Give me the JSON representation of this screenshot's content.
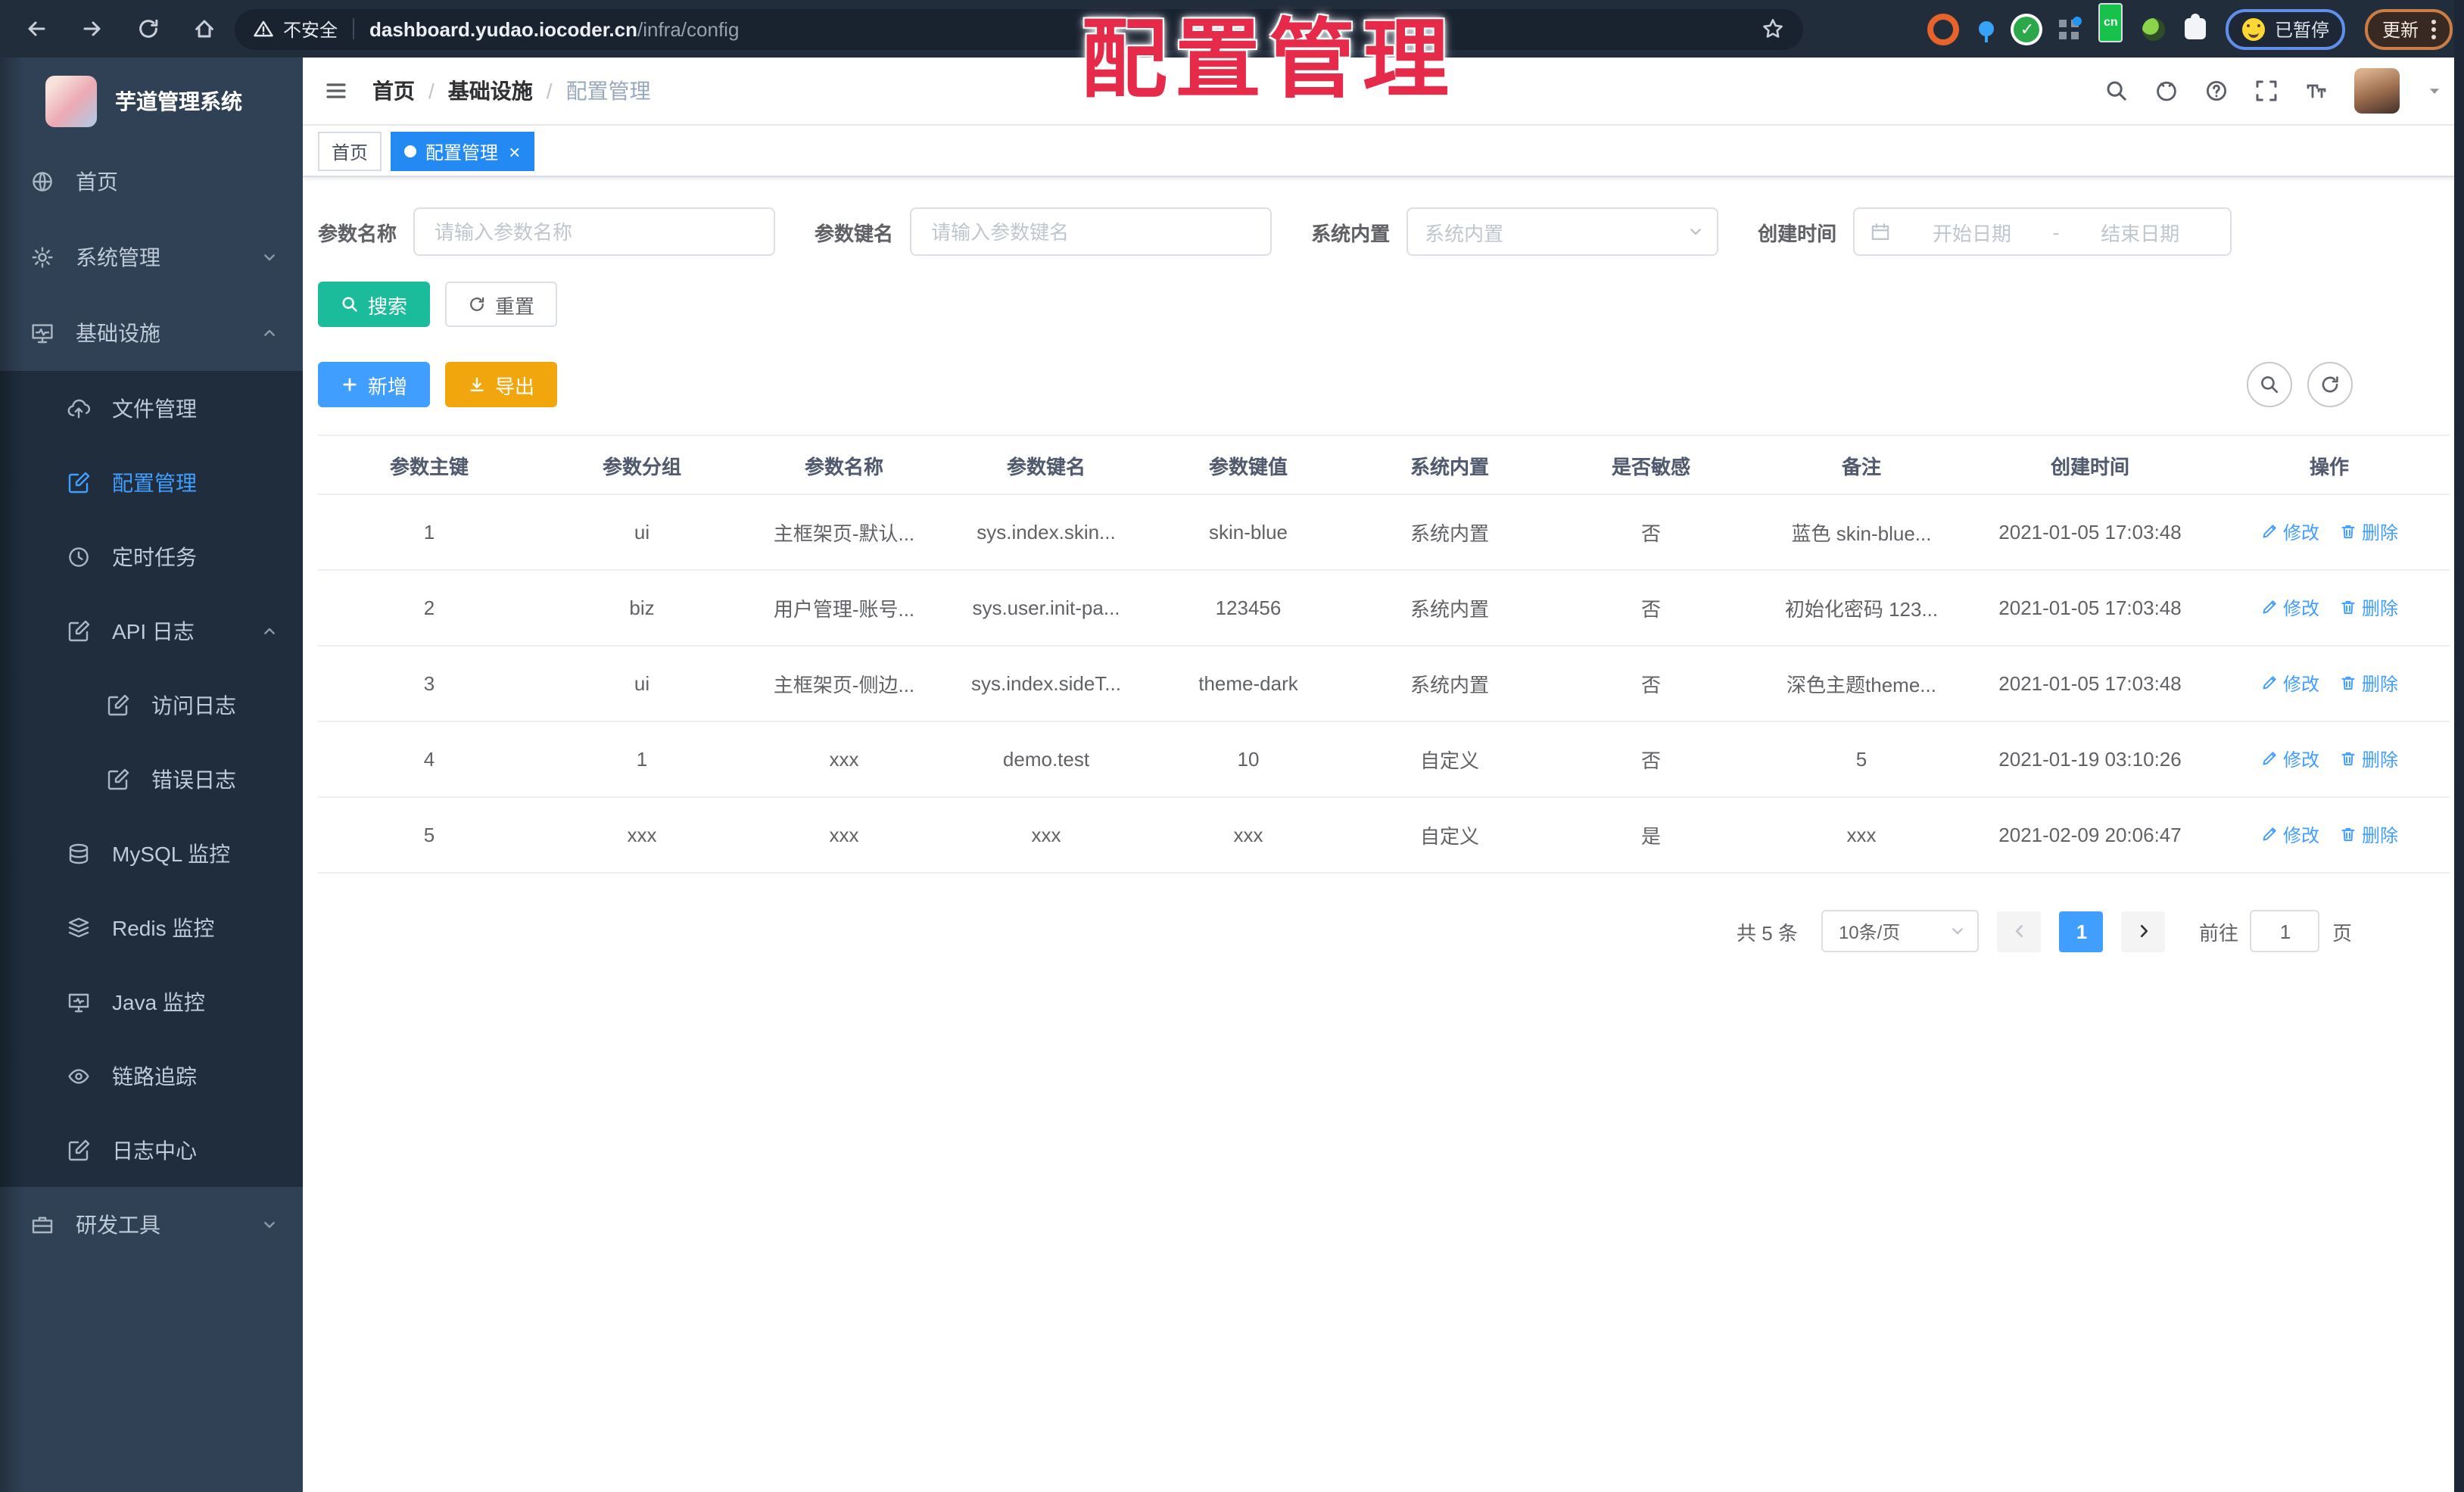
{
  "colors": {
    "accent": "#409eff",
    "active_tag": "#2389f3",
    "search_button": "#1abc9c",
    "export_button": "#f2a60d",
    "annotation_red": "#e62a4a",
    "sidebar_bg": "#304156",
    "submenu_bg": "#1f2d3d",
    "toolbar_bg": "#222d3c"
  },
  "browser": {
    "security_label": "不安全",
    "url_host": "dashboard.yudao.iocoder.cn",
    "url_path": "/infra/config",
    "ext_cn_label": "cn",
    "paused_label": "已暂停",
    "update_label": "更新"
  },
  "annotation": {
    "text": "配置管理"
  },
  "sidebar": {
    "logo_title": "芋道管理系统",
    "items": [
      {
        "label": "首页",
        "icon": "home-globe-icon",
        "level": 1
      },
      {
        "label": "系统管理",
        "icon": "gear-icon",
        "level": 1,
        "arrow": "down"
      },
      {
        "label": "基础设施",
        "icon": "infra-monitor-icon",
        "level": 1,
        "arrow": "up"
      },
      {
        "label": "文件管理",
        "icon": "cloud-upload-icon",
        "level": 2
      },
      {
        "label": "配置管理",
        "icon": "edit-square-icon",
        "level": 2,
        "active": true
      },
      {
        "label": "定时任务",
        "icon": "clock-icon",
        "level": 2
      },
      {
        "label": "API 日志",
        "icon": "api-log-icon",
        "level": 2,
        "arrow": "up"
      },
      {
        "label": "访问日志",
        "icon": "doc-edit-icon",
        "level": 3
      },
      {
        "label": "错误日志",
        "icon": "doc-edit-icon",
        "level": 3
      },
      {
        "label": "MySQL 监控",
        "icon": "mysql-db-icon",
        "level": 2
      },
      {
        "label": "Redis 监控",
        "icon": "redis-stack-icon",
        "level": 2
      },
      {
        "label": "Java 监控",
        "icon": "java-monitor-icon",
        "level": 2
      },
      {
        "label": "链路追踪",
        "icon": "eye-icon",
        "level": 2
      },
      {
        "label": "日志中心",
        "icon": "log-center-icon",
        "level": 2
      },
      {
        "label": "研发工具",
        "icon": "briefcase-icon",
        "level": 1,
        "arrow": "down"
      }
    ]
  },
  "header": {
    "breadcrumb": [
      "首页",
      "基础设施",
      "配置管理"
    ],
    "breadcrumb_separator": "/"
  },
  "tags": [
    {
      "label": "首页",
      "active": false,
      "closable": false
    },
    {
      "label": "配置管理",
      "active": true,
      "closable": true,
      "close_glyph": "×"
    }
  ],
  "filters": {
    "name": {
      "label": "参数名称",
      "placeholder": "请输入参数名称"
    },
    "key": {
      "label": "参数键名",
      "placeholder": "请输入参数键名"
    },
    "type": {
      "label": "系统内置",
      "placeholder": "系统内置"
    },
    "date": {
      "label": "创建时间",
      "start_placeholder": "开始日期",
      "separator": "-",
      "end_placeholder": "结束日期"
    }
  },
  "toolbar": {
    "search": "搜索",
    "reset": "重置",
    "add": "新增",
    "export": "导出"
  },
  "table": {
    "columns": [
      "参数主键",
      "参数分组",
      "参数名称",
      "参数键名",
      "参数键值",
      "系统内置",
      "是否敏感",
      "备注",
      "创建时间",
      "操作"
    ],
    "rows": [
      [
        "1",
        "ui",
        "主框架页-默认...",
        "sys.index.skin...",
        "skin-blue",
        "系统内置",
        "否",
        "蓝色 skin-blue...",
        "2021-01-05 17:03:48"
      ],
      [
        "2",
        "biz",
        "用户管理-账号...",
        "sys.user.init-pa...",
        "123456",
        "系统内置",
        "否",
        "初始化密码 123...",
        "2021-01-05 17:03:48"
      ],
      [
        "3",
        "ui",
        "主框架页-侧边...",
        "sys.index.sideT...",
        "theme-dark",
        "系统内置",
        "否",
        "深色主题theme...",
        "2021-01-05 17:03:48"
      ],
      [
        "4",
        "1",
        "xxx",
        "demo.test",
        "10",
        "自定义",
        "否",
        "5",
        "2021-01-19 03:10:26"
      ],
      [
        "5",
        "xxx",
        "xxx",
        "xxx",
        "xxx",
        "自定义",
        "是",
        "xxx",
        "2021-02-09 20:06:47"
      ]
    ],
    "edit_label": "修改",
    "delete_label": "删除"
  },
  "pagination": {
    "total": "共 5 条",
    "size": "10条/页",
    "page": "1",
    "goto": "前往",
    "goto_value": "1",
    "unit": "页"
  }
}
